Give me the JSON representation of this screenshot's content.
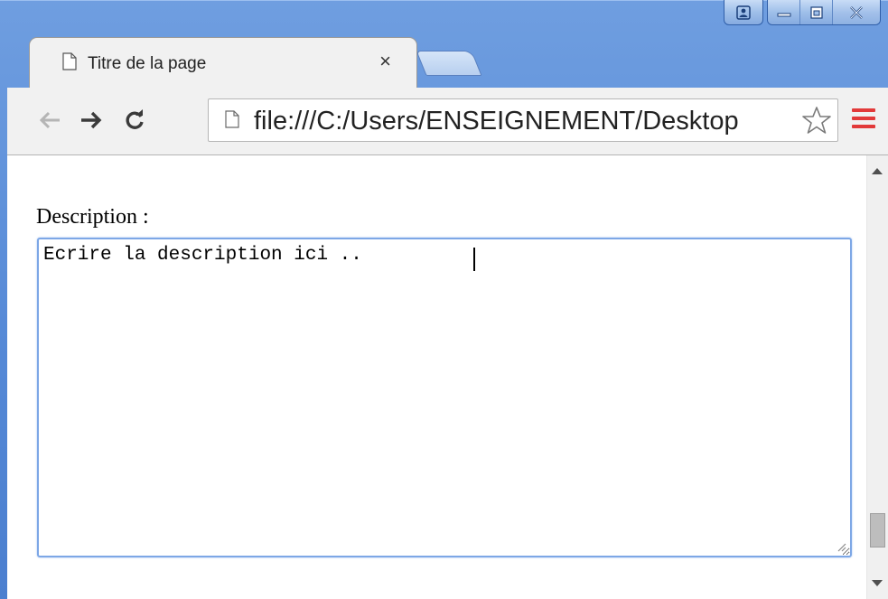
{
  "window": {
    "controls": [
      "profile-icon",
      "minimize-icon",
      "maximize-icon",
      "close-icon"
    ]
  },
  "tab": {
    "title": "Titre de la page",
    "close_label": "×"
  },
  "toolbar": {
    "url": "file:///C:/Users/ENSEIGNEMENT/Desktop",
    "menu_color": "#e23a3a"
  },
  "form": {
    "label": "Description :",
    "textarea_value": "Ecrire la description ici .."
  }
}
